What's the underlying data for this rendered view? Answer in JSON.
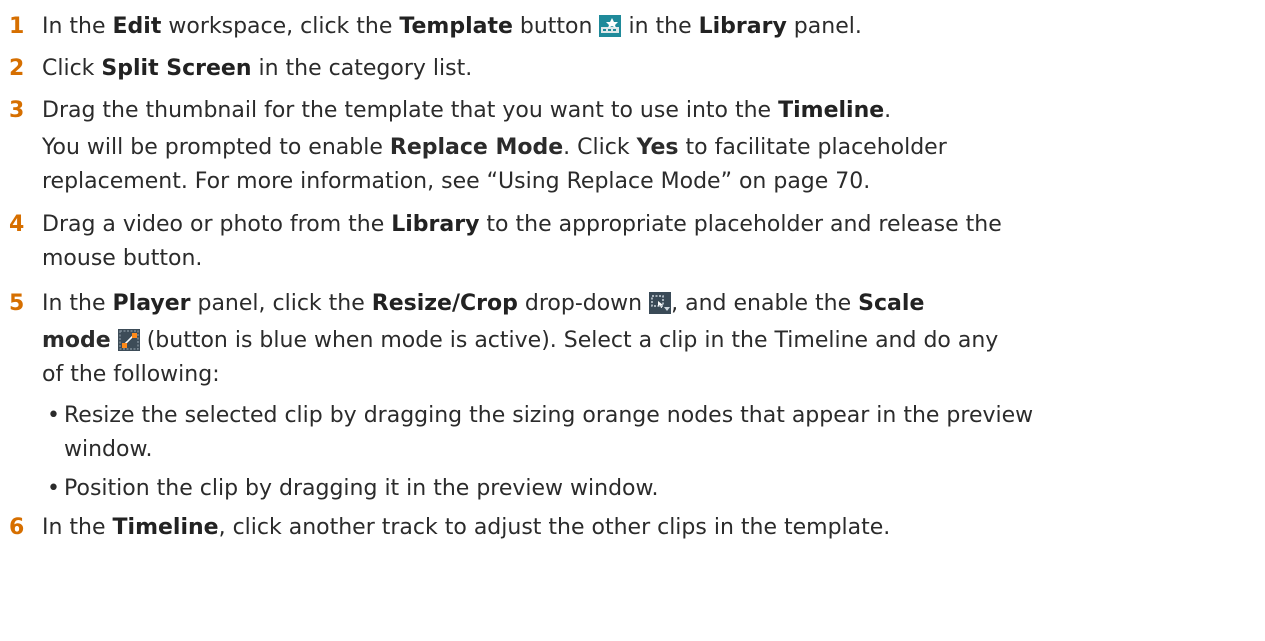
{
  "steps": [
    {
      "num": "1",
      "parts": [
        "In the ",
        "Edit",
        " workspace, click the ",
        "Template",
        " button ",
        " in the ",
        "Library",
        " panel."
      ]
    },
    {
      "num": "2",
      "parts": [
        "Click ",
        "Split Screen",
        " in the category list."
      ]
    },
    {
      "num": "3",
      "parts": [
        "Drag the thumbnail for the template that you want to use into the ",
        "Timeline",
        "."
      ],
      "sub": [
        "You will be prompted to enable ",
        "Replace Mode",
        ". Click ",
        "Yes",
        " to facilitate placeholder",
        "replacement. For more information, see “Using Replace Mode” on page 70."
      ]
    },
    {
      "num": "4",
      "parts": [
        "Drag a video or photo from the ",
        "Library",
        " to the appropriate placeholder and release the",
        "mouse button."
      ]
    },
    {
      "num": "5",
      "parts": [
        "In the ",
        "Player",
        " panel, click the ",
        "Resize/Crop",
        " drop-down ",
        ", and enable the ",
        "Scale",
        "mode",
        " (button is blue when mode is active). Select a clip in the Timeline and do any",
        "of the following:"
      ],
      "bullets": [
        [
          "Resize the selected clip by dragging the sizing orange nodes that appear in the preview",
          "window."
        ],
        [
          "Position the clip by dragging it in the preview window."
        ]
      ]
    },
    {
      "num": "6",
      "parts": [
        "In the ",
        "Timeline",
        ", click another track to adjust the other clips in the template."
      ]
    }
  ],
  "icons": {
    "template": "template-icon",
    "resize_crop": "resize-crop-icon",
    "scale_mode": "scale-mode-icon"
  },
  "colors": {
    "step_number": "#d66f00",
    "text": "#2b2b2b"
  }
}
